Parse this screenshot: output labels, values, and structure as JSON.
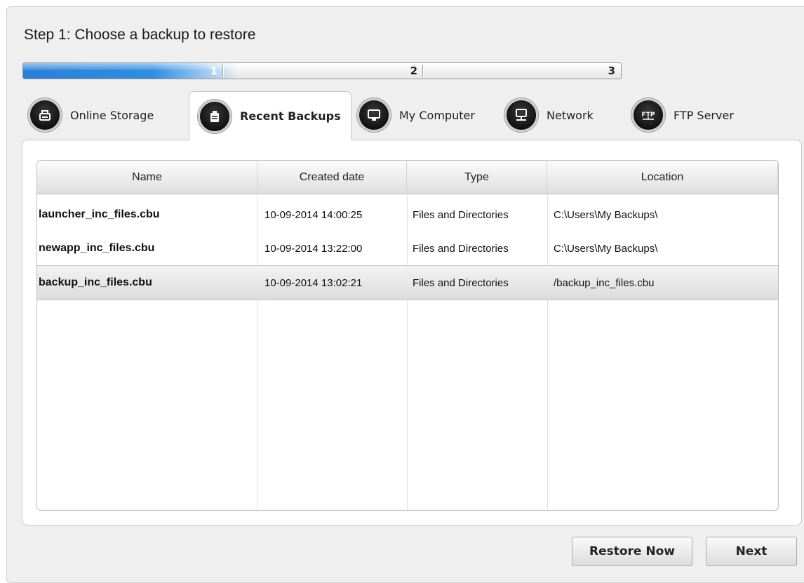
{
  "step": {
    "title": "Step 1: Choose a backup to restore"
  },
  "progress": {
    "segments": [
      "1",
      "2",
      "3"
    ],
    "current_step": 1,
    "fill_fraction": 0.36
  },
  "tabs": [
    {
      "label": "Online Storage",
      "icon": "online-storage-icon",
      "active": false
    },
    {
      "label": "Recent Backups",
      "icon": "recent-backups-icon",
      "active": true
    },
    {
      "label": "My Computer",
      "icon": "my-computer-icon",
      "active": false
    },
    {
      "label": "Network",
      "icon": "network-icon",
      "active": false
    },
    {
      "label": "FTP Server",
      "icon": "ftp-server-icon",
      "active": false
    }
  ],
  "table": {
    "columns": [
      "Name",
      "Created date",
      "Type",
      "Location"
    ],
    "rows": [
      {
        "name": "launcher_inc_files.cbu",
        "created": "10-09-2014 14:00:25",
        "type": "Files and Directories",
        "location": "C:\\Users\\My Backups\\",
        "selected": false
      },
      {
        "name": "newapp_inc_files.cbu",
        "created": "10-09-2014 13:22:00",
        "type": "Files and Directories",
        "location": "C:\\Users\\My Backups\\",
        "selected": false
      },
      {
        "name": "backup_inc_files.cbu",
        "created": "10-09-2014 13:02:21",
        "type": "Files and Directories",
        "location": "/backup_inc_files.cbu",
        "selected": true
      }
    ]
  },
  "buttons": {
    "restore_now": "Restore Now",
    "next": "Next"
  },
  "colors": {
    "progress_blue": "#2b7fd6",
    "panel_bg": "#efefef"
  }
}
